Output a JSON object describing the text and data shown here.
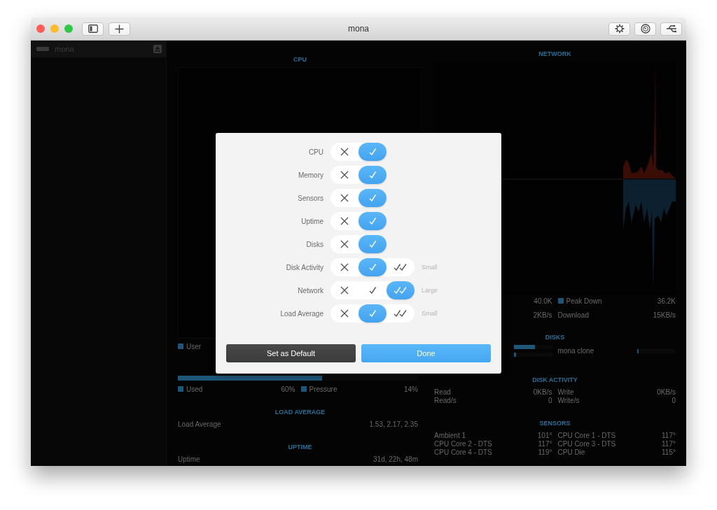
{
  "window": {
    "title": "mona"
  },
  "sidebar": {
    "items": [
      {
        "label": "mona"
      }
    ]
  },
  "cpu": {
    "title": "CPU",
    "legend": [
      {
        "label": "User",
        "swatch": true
      }
    ]
  },
  "memory": {
    "level": 0.6,
    "legend": [
      {
        "label": "Used",
        "value": "60%",
        "swatch": true
      },
      {
        "label": "Pressure",
        "value": "14%",
        "swatch": true
      }
    ]
  },
  "load_average": {
    "title": "LOAD AVERAGE",
    "rows": [
      {
        "label": "Load Average",
        "value": "1.53, 2.17, 2.35"
      }
    ]
  },
  "uptime": {
    "title": "UPTIME",
    "rows": [
      {
        "label": "Uptime",
        "value": "31d, 22h, 48m"
      }
    ]
  },
  "network": {
    "title": "NETWORK",
    "stats": [
      {
        "value": "40.0K"
      },
      {
        "label": "Peak Down",
        "value": "36.2K",
        "swatch": true
      },
      {
        "value": "2KB/s"
      },
      {
        "label": "Download",
        "value": "15KB/s"
      }
    ]
  },
  "disks": {
    "title": "DISKS",
    "entries": [
      {
        "meters": [
          {
            "level": 0.55
          },
          {
            "level": 0.06
          }
        ]
      },
      {
        "name": "mona clone",
        "meters": [
          {
            "level": 0.04
          }
        ]
      }
    ]
  },
  "disk_activity": {
    "title": "DISK ACTIVITY",
    "stats": [
      {
        "label": "Read",
        "value": "0KB/s"
      },
      {
        "label": "Write",
        "value": "0KB/s"
      },
      {
        "label": "Read/s",
        "value": "0"
      },
      {
        "label": "Write/s",
        "value": "0"
      }
    ]
  },
  "sensors": {
    "title": "SENSORS",
    "readings": [
      {
        "label": "Ambient 1",
        "value": "101°"
      },
      {
        "label": "CPU Core 1 - DTS",
        "value": "117°"
      },
      {
        "label": "CPU Core 2 - DTS",
        "value": "117°"
      },
      {
        "label": "CPU Core 3 - DTS",
        "value": "117°"
      },
      {
        "label": "CPU Core 4 - DTS",
        "value": "119°"
      },
      {
        "label": "CPU Die",
        "value": "115°"
      }
    ]
  },
  "dialog": {
    "rows": [
      {
        "label": "CPU",
        "options": [
          {
            "kind": "off",
            "selected": false
          },
          {
            "kind": "on",
            "selected": true
          }
        ]
      },
      {
        "label": "Memory",
        "options": [
          {
            "kind": "off",
            "selected": false
          },
          {
            "kind": "on",
            "selected": true
          }
        ]
      },
      {
        "label": "Sensors",
        "options": [
          {
            "kind": "off",
            "selected": false
          },
          {
            "kind": "on",
            "selected": true
          }
        ]
      },
      {
        "label": "Uptime",
        "options": [
          {
            "kind": "off",
            "selected": false
          },
          {
            "kind": "on",
            "selected": true
          }
        ]
      },
      {
        "label": "Disks",
        "options": [
          {
            "kind": "off",
            "selected": false
          },
          {
            "kind": "on",
            "selected": true
          }
        ]
      },
      {
        "label": "Disk Activity",
        "options": [
          {
            "kind": "off",
            "selected": false
          },
          {
            "kind": "on",
            "selected": true
          },
          {
            "kind": "detailed",
            "selected": false
          }
        ],
        "note": "Small"
      },
      {
        "label": "Network",
        "options": [
          {
            "kind": "off",
            "selected": false
          },
          {
            "kind": "on",
            "selected": false
          },
          {
            "kind": "detailed",
            "selected": true
          }
        ],
        "note": "Large"
      },
      {
        "label": "Load Average",
        "options": [
          {
            "kind": "off",
            "selected": false
          },
          {
            "kind": "on",
            "selected": true
          },
          {
            "kind": "detailed",
            "selected": false
          }
        ],
        "note": "Small"
      }
    ],
    "buttons": [
      {
        "label": "Set as Default",
        "kind": "secondary"
      },
      {
        "label": "Done",
        "kind": "primary"
      }
    ]
  }
}
